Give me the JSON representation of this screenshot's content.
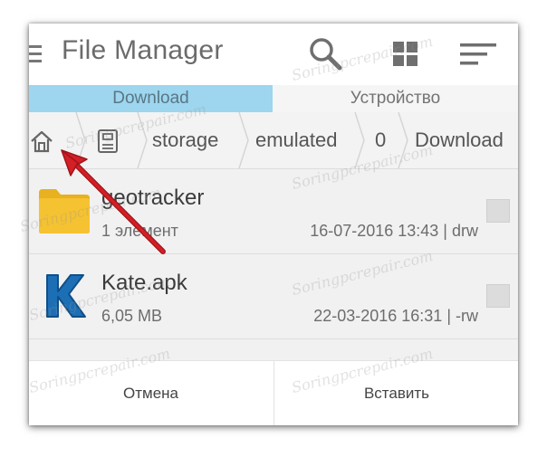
{
  "header": {
    "title": "File Manager",
    "menu_icon": "menu-icon",
    "search_icon": "search-icon",
    "grid_icon": "grid-view-icon",
    "sort_icon": "sort-icon"
  },
  "tabs": [
    {
      "label": "Download",
      "active": true
    },
    {
      "label": "Устройство",
      "active": false
    }
  ],
  "breadcrumb": {
    "home_icon": "home-icon",
    "sdcard_icon": "sd-card-icon",
    "items": [
      "storage",
      "emulated",
      "0",
      "Download"
    ]
  },
  "files": [
    {
      "name": "geotracker",
      "meta": "1 элемент",
      "date": "16-07-2016 13:43 | drw",
      "icon": "folder-icon"
    },
    {
      "name": "Kate.apk",
      "meta": "6,05 MB",
      "date": "22-03-2016 16:31 | -rw",
      "icon": "kate-app-icon"
    }
  ],
  "footer": {
    "cancel_label": "Отмена",
    "paste_label": "Вставить"
  },
  "watermark": "Soringpcrepair.com",
  "colors": {
    "active_tab": "#9dd6ee",
    "folder": "#f5c231",
    "kate_blue": "#1d6fb5",
    "arrow": "#d31f26"
  }
}
